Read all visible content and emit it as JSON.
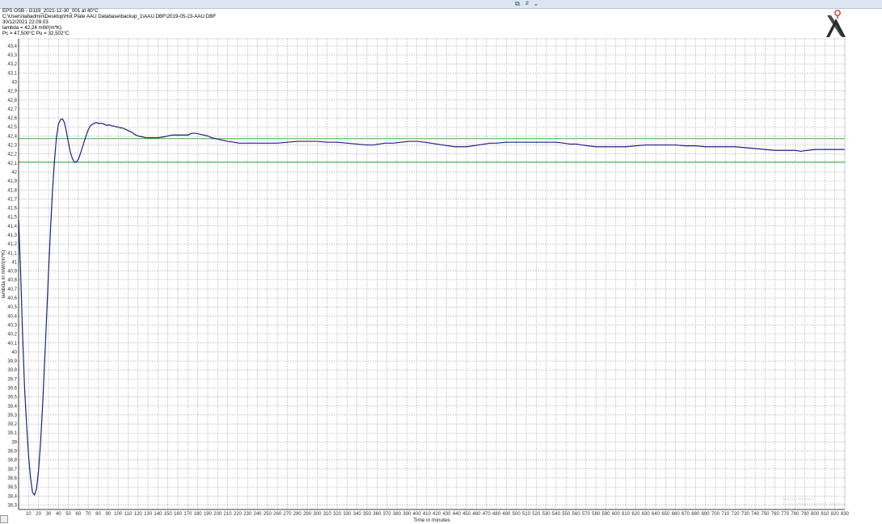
{
  "window": {
    "colors": {
      "titlebar": "#dce6f3"
    }
  },
  "header": {
    "line1": "EPS OSB - G119_2021-12-30_001 at 40°C",
    "line2": "C:\\Users\\labadmin\\Desktop\\Hot Plate AAU Database\\backup_1\\AAU.DBF\\2019-05-23-AAU.DBF",
    "line3": "30/12/2021 22.09.03",
    "line4": "lambda = 42,24 mW/(m*K)",
    "line5": "Pc = 47,500°C   Pu = 32,502°C"
  },
  "watermark": {
    "line1": "Activate Windows",
    "line2": "Go to Settings to activate Windows."
  },
  "colors": {
    "curve": "#1a237e",
    "reference_lines": "#3cb043",
    "grid": "#9e9e9e",
    "axis": "#000000",
    "logo_dark": "#2b2b2b",
    "logo_accent": "#d9342b"
  },
  "chart_data": {
    "type": "line",
    "title": "",
    "xlabel": "Time in minutes",
    "ylabel": "lambda in mW/(m*K)",
    "xlim": [
      0,
      830
    ],
    "ylim": [
      38.25,
      43.48
    ],
    "x_ticks": [
      10,
      20,
      30,
      40,
      50,
      60,
      70,
      80,
      90,
      100,
      110,
      120,
      130,
      140,
      150,
      160,
      170,
      180,
      190,
      200,
      210,
      220,
      230,
      240,
      250,
      260,
      270,
      280,
      290,
      300,
      310,
      320,
      330,
      340,
      350,
      360,
      370,
      380,
      390,
      400,
      410,
      420,
      430,
      440,
      450,
      460,
      470,
      480,
      490,
      500,
      510,
      520,
      530,
      540,
      550,
      560,
      570,
      580,
      590,
      600,
      610,
      620,
      630,
      640,
      650,
      660,
      670,
      680,
      690,
      700,
      710,
      720,
      730,
      740,
      750,
      760,
      770,
      780,
      790,
      800,
      810,
      820,
      830
    ],
    "y_ticks": [
      "38,3",
      "38,4",
      "38,5",
      "38,6",
      "38,7",
      "38,8",
      "38,9",
      "39",
      "39,1",
      "39,2",
      "39,3",
      "39,4",
      "39,5",
      "39,6",
      "39,7",
      "39,8",
      "39,9",
      "40",
      "40,1",
      "40,2",
      "40,3",
      "40,4",
      "40,5",
      "40,6",
      "40,7",
      "40,8",
      "40,9",
      "41",
      "41,1",
      "41,2",
      "41,3",
      "41,4",
      "41,5",
      "41,6",
      "41,7",
      "41,8",
      "41,9",
      "42",
      "42,1",
      "42,2",
      "42,3",
      "42,4",
      "42,5",
      "42,6",
      "42,7",
      "42,8",
      "42,9",
      "43",
      "43,1",
      "43,2",
      "43,3",
      "43,4"
    ],
    "grid": true,
    "legend": "none",
    "reference_lines_y": [
      42.37,
      42.11
    ],
    "series": [
      {
        "points": [
          [
            0,
            41.47
          ],
          [
            2,
            40.9
          ],
          [
            4,
            40.2
          ],
          [
            6,
            39.6
          ],
          [
            8,
            39.2
          ],
          [
            10,
            38.85
          ],
          [
            12,
            38.6
          ],
          [
            14,
            38.44
          ],
          [
            16,
            38.41
          ],
          [
            18,
            38.48
          ],
          [
            20,
            38.68
          ],
          [
            22,
            38.98
          ],
          [
            24,
            39.38
          ],
          [
            26,
            39.85
          ],
          [
            28,
            40.35
          ],
          [
            30,
            40.87
          ],
          [
            32,
            41.35
          ],
          [
            34,
            41.78
          ],
          [
            36,
            42.12
          ],
          [
            38,
            42.38
          ],
          [
            40,
            42.53
          ],
          [
            42,
            42.58
          ],
          [
            44,
            42.59
          ],
          [
            46,
            42.55
          ],
          [
            48,
            42.45
          ],
          [
            50,
            42.33
          ],
          [
            52,
            42.22
          ],
          [
            54,
            42.15
          ],
          [
            56,
            42.11
          ],
          [
            58,
            42.11
          ],
          [
            60,
            42.14
          ],
          [
            62,
            42.2
          ],
          [
            64,
            42.27
          ],
          [
            66,
            42.34
          ],
          [
            68,
            42.41
          ],
          [
            70,
            42.47
          ],
          [
            72,
            42.51
          ],
          [
            74,
            42.53
          ],
          [
            76,
            42.54
          ],
          [
            78,
            42.55
          ],
          [
            80,
            42.54
          ],
          [
            82,
            42.54
          ],
          [
            84,
            42.54
          ],
          [
            86,
            42.53
          ],
          [
            88,
            42.52
          ],
          [
            90,
            42.52
          ],
          [
            92,
            42.52
          ],
          [
            94,
            42.51
          ],
          [
            96,
            42.51
          ],
          [
            98,
            42.5
          ],
          [
            100,
            42.5
          ],
          [
            102,
            42.49
          ],
          [
            104,
            42.49
          ],
          [
            106,
            42.48
          ],
          [
            108,
            42.47
          ],
          [
            110,
            42.46
          ],
          [
            112,
            42.45
          ],
          [
            114,
            42.44
          ],
          [
            116,
            42.42
          ],
          [
            118,
            42.41
          ],
          [
            120,
            42.4
          ],
          [
            124,
            42.39
          ],
          [
            128,
            42.38
          ],
          [
            132,
            42.38
          ],
          [
            136,
            42.38
          ],
          [
            140,
            42.38
          ],
          [
            146,
            42.39
          ],
          [
            150,
            42.4
          ],
          [
            154,
            42.41
          ],
          [
            158,
            42.41
          ],
          [
            162,
            42.41
          ],
          [
            166,
            42.41
          ],
          [
            170,
            42.41
          ],
          [
            174,
            42.43
          ],
          [
            178,
            42.43
          ],
          [
            182,
            42.42
          ],
          [
            186,
            42.41
          ],
          [
            190,
            42.4
          ],
          [
            194,
            42.38
          ],
          [
            198,
            42.37
          ],
          [
            202,
            42.36
          ],
          [
            206,
            42.35
          ],
          [
            210,
            42.34
          ],
          [
            216,
            42.33
          ],
          [
            222,
            42.32
          ],
          [
            230,
            42.32
          ],
          [
            240,
            42.32
          ],
          [
            250,
            42.32
          ],
          [
            260,
            42.32
          ],
          [
            270,
            42.33
          ],
          [
            280,
            42.34
          ],
          [
            290,
            42.34
          ],
          [
            300,
            42.34
          ],
          [
            310,
            42.33
          ],
          [
            320,
            42.33
          ],
          [
            330,
            42.32
          ],
          [
            340,
            42.31
          ],
          [
            350,
            42.3
          ],
          [
            356,
            42.3
          ],
          [
            362,
            42.31
          ],
          [
            368,
            42.32
          ],
          [
            376,
            42.32
          ],
          [
            384,
            42.33
          ],
          [
            392,
            42.34
          ],
          [
            400,
            42.34
          ],
          [
            408,
            42.33
          ],
          [
            414,
            42.32
          ],
          [
            420,
            42.31
          ],
          [
            426,
            42.3
          ],
          [
            432,
            42.29
          ],
          [
            438,
            42.28
          ],
          [
            444,
            42.28
          ],
          [
            450,
            42.28
          ],
          [
            456,
            42.29
          ],
          [
            462,
            42.3
          ],
          [
            468,
            42.31
          ],
          [
            474,
            42.32
          ],
          [
            480,
            42.32
          ],
          [
            490,
            42.33
          ],
          [
            500,
            42.33
          ],
          [
            510,
            42.33
          ],
          [
            520,
            42.33
          ],
          [
            530,
            42.33
          ],
          [
            540,
            42.33
          ],
          [
            548,
            42.32
          ],
          [
            554,
            42.31
          ],
          [
            560,
            42.31
          ],
          [
            566,
            42.3
          ],
          [
            572,
            42.29
          ],
          [
            580,
            42.28
          ],
          [
            590,
            42.28
          ],
          [
            600,
            42.28
          ],
          [
            610,
            42.28
          ],
          [
            620,
            42.29
          ],
          [
            630,
            42.3
          ],
          [
            640,
            42.3
          ],
          [
            650,
            42.3
          ],
          [
            660,
            42.3
          ],
          [
            670,
            42.29
          ],
          [
            680,
            42.29
          ],
          [
            690,
            42.28
          ],
          [
            700,
            42.28
          ],
          [
            710,
            42.28
          ],
          [
            720,
            42.28
          ],
          [
            730,
            42.27
          ],
          [
            740,
            42.26
          ],
          [
            750,
            42.25
          ],
          [
            760,
            42.24
          ],
          [
            770,
            42.24
          ],
          [
            780,
            42.24
          ],
          [
            786,
            42.23
          ],
          [
            792,
            42.24
          ],
          [
            800,
            42.25
          ],
          [
            810,
            42.25
          ],
          [
            820,
            42.25
          ],
          [
            830,
            42.25
          ]
        ]
      }
    ]
  }
}
